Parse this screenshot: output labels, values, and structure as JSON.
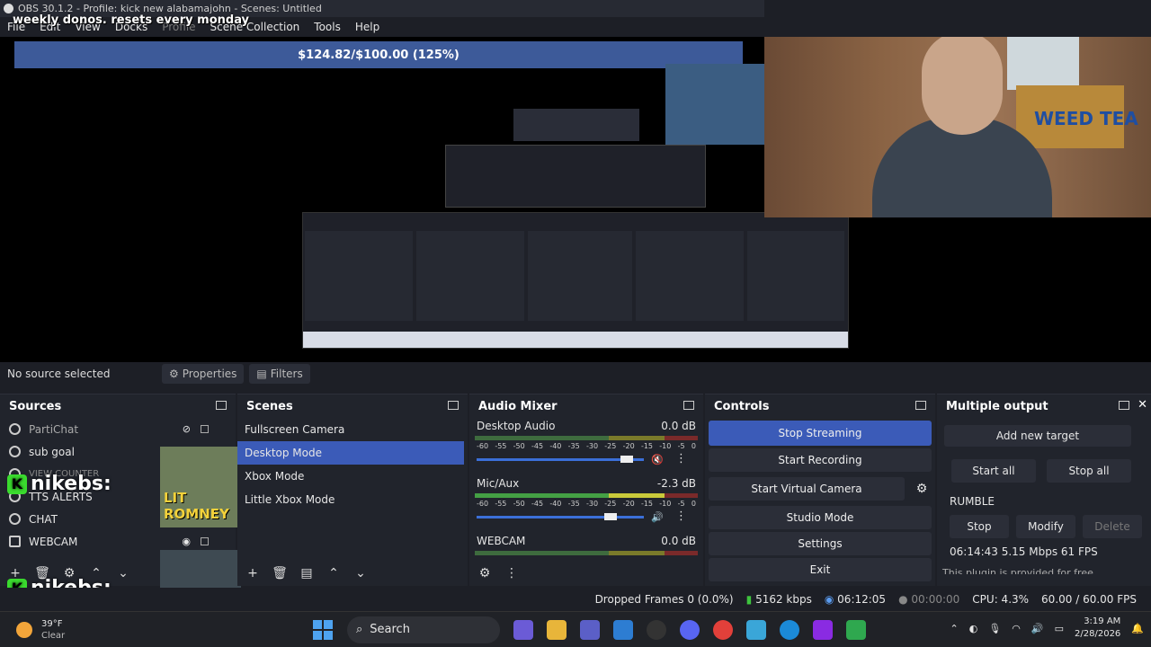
{
  "window": {
    "title": "OBS 30.1.2 - Profile: kick new alabamajohn - Scenes: Untitled"
  },
  "overlay_text": "weekly donos. resets every monday",
  "menu": [
    "File",
    "Edit",
    "View",
    "Docks",
    "Profile",
    "Scene Collection",
    "Tools",
    "Help"
  ],
  "preview": {
    "goal_text": "$124.82/$100.00 (125%)",
    "webcam_sign": "WEED TEA"
  },
  "source_bar": {
    "selection": "No source selected",
    "properties": "Properties",
    "filters": "Filters"
  },
  "sources": {
    "title": "Sources",
    "items": [
      "PartiChat",
      "sub goal",
      "VIEW COUNTER",
      "TTS ALERTS",
      "CHAT",
      "WEBCAM"
    ]
  },
  "scenes": {
    "title": "Scenes",
    "items": [
      "Fullscreen Camera",
      "Desktop Mode",
      "Xbox Mode",
      "Little Xbox Mode"
    ],
    "selected_index": 1
  },
  "mixer": {
    "title": "Audio Mixer",
    "ticks": [
      "-60",
      "-55",
      "-50",
      "-45",
      "-40",
      "-35",
      "-30",
      "-25",
      "-20",
      "-15",
      "-10",
      "-5",
      "0"
    ],
    "channels": [
      {
        "name": "Desktop Audio",
        "level": "0.0 dB",
        "muted": true
      },
      {
        "name": "Mic/Aux",
        "level": "-2.3 dB",
        "muted": false
      },
      {
        "name": "WEBCAM",
        "level": "0.0 dB",
        "muted": false
      }
    ]
  },
  "controls": {
    "title": "Controls",
    "stop_streaming": "Stop Streaming",
    "start_recording": "Start Recording",
    "start_virtual_camera": "Start Virtual Camera",
    "studio_mode": "Studio Mode",
    "settings": "Settings",
    "exit": "Exit"
  },
  "multi_output": {
    "title": "Multiple output",
    "add_target": "Add new target",
    "start_all": "Start all",
    "stop_all": "Stop all",
    "target_name": "RUMBLE",
    "stop": "Stop",
    "modify": "Modify",
    "delete": "Delete",
    "stats": "06:14:43  5.15 Mbps  61 FPS",
    "footer_note": "This plugin is provided for free"
  },
  "status": {
    "dropped": "Dropped Frames 0 (0.0%)",
    "bitrate": "5162 kbps",
    "stream_time": "06:12:05",
    "rec_time": "00:00:00",
    "cpu": "CPU: 4.3%",
    "fps": "60.00 / 60.00 FPS"
  },
  "overlays": {
    "handle": "nikebs:",
    "lit_line1": "LIT",
    "lit_line2": "ROMNEY"
  },
  "taskbar": {
    "temp": "39°F",
    "condition": "Clear",
    "search": "Search",
    "time": "3:19 AM",
    "date": "2/28/2026"
  }
}
